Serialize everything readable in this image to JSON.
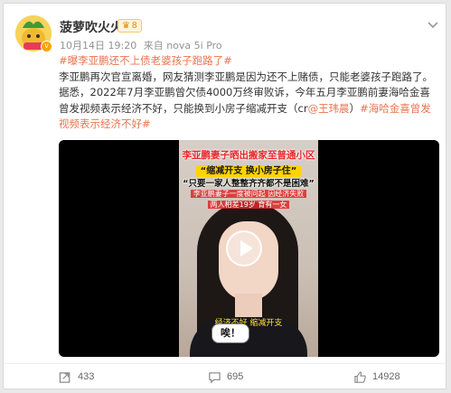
{
  "post": {
    "username": "菠萝吹火火",
    "level_badge": "8",
    "time": "10月14日 19:20",
    "source": "来自 nova 5i Pro",
    "text": {
      "topic1": "#曝李亚鹏还不上债老婆孩子跑路了#",
      "body": "李亚鹏再次官宣离婚，网友猜测李亚鹏是因为还不上赌债，只能老婆孩子跑路了。据悉，2022年7月李亚鹏曾欠债4000万终审败诉，今年五月李亚鹏前妻海哈金喜曾发视频表示经济不好，只能换到小房子缩减开支（cr",
      "mention": "@王玮晨",
      "close": "）",
      "topic2": "#海哈金喜曾发视频表示经济不好#"
    },
    "video": {
      "overlay_title": "李亚鹏妻子晒出搬家至普通小区",
      "overlay_tag": "“缩减开支 换小房子住”",
      "overlay_quote": "“只要一家人整整齐齐都不是困难”",
      "overlay_line4": "李亚鹏妻子一度被问起 因经济失败",
      "overlay_line5": "两人相差19岁 育有一女",
      "caption": "经济不好  缩减开支",
      "bubble": "唉！"
    },
    "actions": {
      "repost_count": "433",
      "comment_count": "695",
      "like_count": "14928"
    }
  },
  "colors": {
    "accent": "#eb7350",
    "badge": "#f7a400"
  },
  "icons": {
    "more": "chevron-down-icon",
    "repost": "repost-icon",
    "comment": "comment-icon",
    "like": "thumbs-up-icon",
    "play": "play-icon"
  }
}
